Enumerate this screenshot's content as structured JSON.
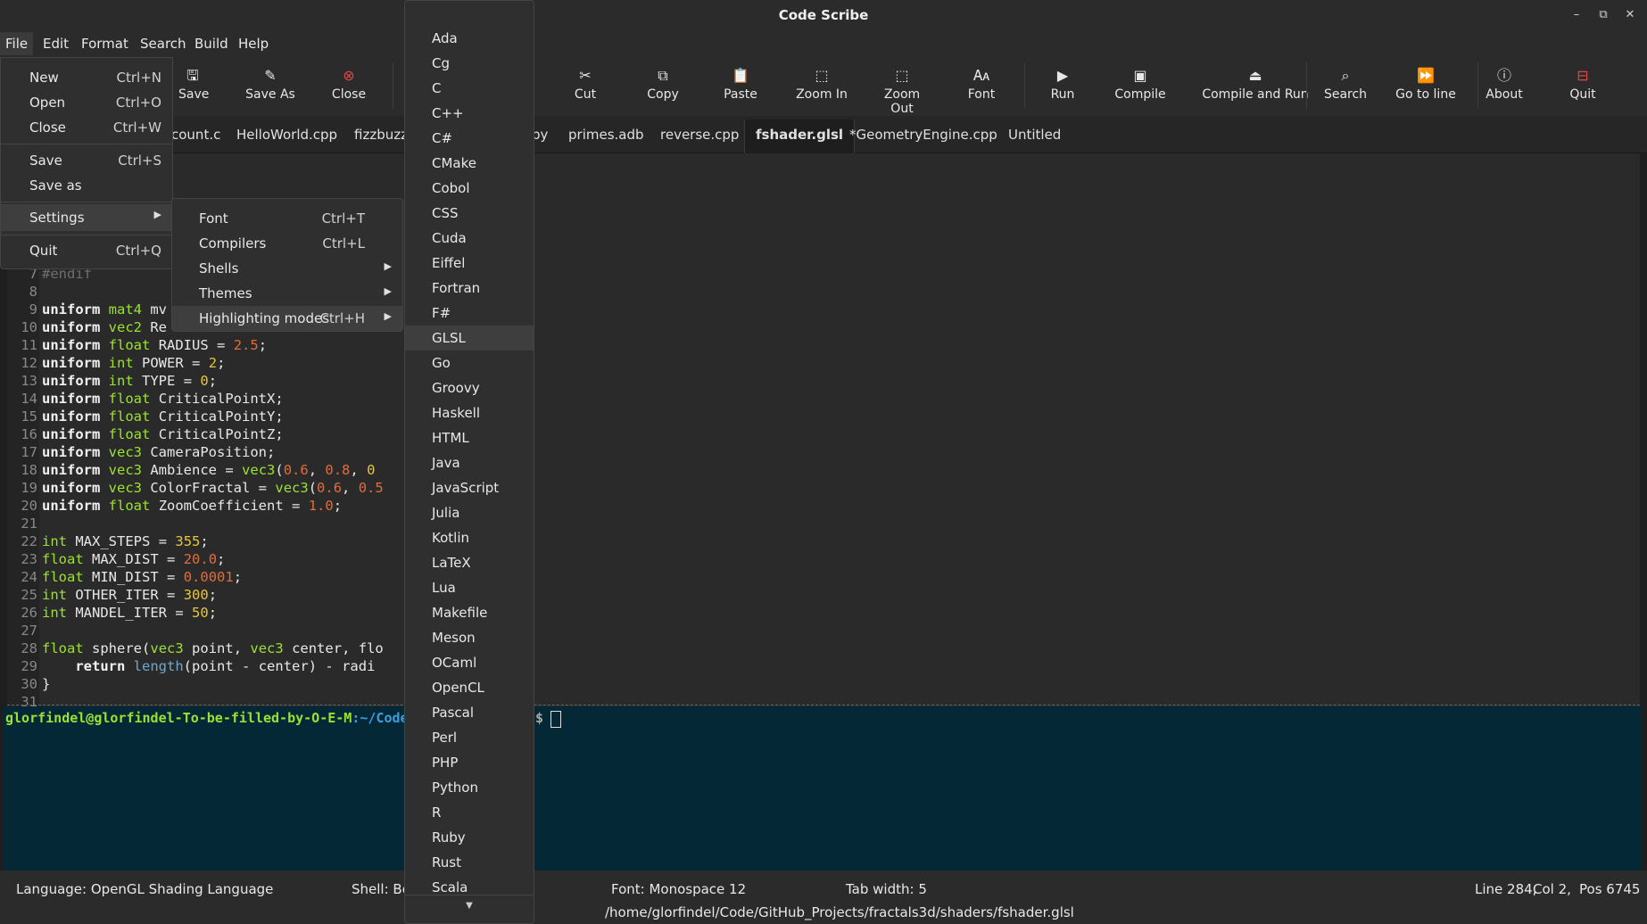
{
  "window": {
    "title": "Code Scribe"
  },
  "menubar": {
    "items": [
      "File",
      "Edit",
      "Format",
      "Search",
      "Build",
      "Help"
    ]
  },
  "toolbar": {
    "buttons": [
      {
        "label": "Save",
        "icon": "save-icon"
      },
      {
        "label": "Save As",
        "icon": "save-as-icon"
      },
      {
        "label": "Close",
        "icon": "close-circle-icon",
        "color": "#e04646"
      },
      {
        "label": "Cut",
        "icon": "scissors-icon"
      },
      {
        "label": "Copy",
        "icon": "copy-icon"
      },
      {
        "label": "Paste",
        "icon": "paste-icon"
      },
      {
        "label": "Zoom In",
        "icon": "zoom-in-icon"
      },
      {
        "label": "Zoom Out",
        "icon": "zoom-out-icon"
      },
      {
        "label": "Font",
        "icon": "font-icon"
      },
      {
        "label": "Run",
        "icon": "play-icon"
      },
      {
        "label": "Compile",
        "icon": "compile-icon"
      },
      {
        "label": "Compile and Run",
        "icon": "eject-icon"
      },
      {
        "label": "Search",
        "icon": "search-icon"
      },
      {
        "label": "Go to line",
        "icon": "fast-forward-icon"
      },
      {
        "label": "About",
        "icon": "info-icon"
      },
      {
        "label": "Quit",
        "icon": "quit-icon",
        "color": "#e04646"
      }
    ]
  },
  "tabs": {
    "items": [
      "count.c",
      "HelloWorld.cpp",
      "fizzbuzz",
      "py",
      "primes.adb",
      "reverse.cpp",
      "fshader.glsl",
      "*GeometryEngine.cpp",
      "Untitled"
    ],
    "active": "fshader.glsl"
  },
  "editor": {
    "lines": [
      {
        "n": "7",
        "code": "#endif"
      },
      {
        "n": "8",
        "code": ""
      },
      {
        "n": "9",
        "code": "uniform mat4 mv"
      },
      {
        "n": "10",
        "code": "uniform vec2 Re"
      },
      {
        "n": "11",
        "code": "uniform float RADIUS = 2.5;"
      },
      {
        "n": "12",
        "code": "uniform int POWER = 2;"
      },
      {
        "n": "13",
        "code": "uniform int TYPE = 0;"
      },
      {
        "n": "14",
        "code": "uniform float CriticalPointX;"
      },
      {
        "n": "15",
        "code": "uniform float CriticalPointY;"
      },
      {
        "n": "16",
        "code": "uniform float CriticalPointZ;"
      },
      {
        "n": "17",
        "code": "uniform vec3 CameraPosition;"
      },
      {
        "n": "18",
        "code": "uniform vec3 Ambience = vec3(0.6, 0.8, 0"
      },
      {
        "n": "19",
        "code": "uniform vec3 ColorFractal = vec3(0.6, 0.5"
      },
      {
        "n": "20",
        "code": "uniform float ZoomCoefficient = 1.0;"
      },
      {
        "n": "21",
        "code": ""
      },
      {
        "n": "22",
        "code": "int MAX_STEPS = 355;"
      },
      {
        "n": "23",
        "code": "float MAX_DIST = 20.0;"
      },
      {
        "n": "24",
        "code": "float MIN_DIST = 0.0001;"
      },
      {
        "n": "25",
        "code": "int OTHER_ITER = 300;"
      },
      {
        "n": "26",
        "code": "int MANDEL_ITER = 50;"
      },
      {
        "n": "27",
        "code": ""
      },
      {
        "n": "28",
        "code": "float sphere(vec3 point, vec3 center, flo"
      },
      {
        "n": "29",
        "code": "    return length(point - center) - radi"
      },
      {
        "n": "30",
        "code": "}"
      },
      {
        "n": "31",
        "code": ""
      }
    ]
  },
  "terminal": {
    "user_host": "glorfindel@glorfindel-To-be-filled-by-O-E-M",
    "path": ":~/Code",
    "dollar": "$"
  },
  "statusbar": {
    "language": "Language: OpenGL Shading Language",
    "shell": "Shell: Bo",
    "font": "Font: Monospace 12",
    "tab_width": "Tab width: 5",
    "line": "Line 284,",
    "col": "Col 2,",
    "pos": "Pos 6745",
    "filepath": "/home/glorfindel/Code/GitHub_Projects/fractals3d/shaders/fshader.glsl"
  },
  "file_menu": {
    "items": [
      {
        "label": "New",
        "shortcut": "Ctrl+N"
      },
      {
        "label": "Open",
        "shortcut": "Ctrl+O"
      },
      {
        "label": "Close",
        "shortcut": "Ctrl+W"
      },
      {
        "label": "Save",
        "shortcut": "Ctrl+S"
      },
      {
        "label": "Save as",
        "shortcut": ""
      },
      {
        "label": "Settings",
        "shortcut": ""
      },
      {
        "label": "Quit",
        "shortcut": "Ctrl+Q"
      }
    ]
  },
  "settings_menu": {
    "items": [
      {
        "label": "Font",
        "shortcut": "Ctrl+T"
      },
      {
        "label": "Compilers",
        "shortcut": "Ctrl+L"
      },
      {
        "label": "Shells",
        "shortcut": ""
      },
      {
        "label": "Themes",
        "shortcut": ""
      },
      {
        "label": "Highlighting modes",
        "shortcut": "Ctrl+H"
      }
    ]
  },
  "languages_menu": {
    "items": [
      "Ada",
      "Cg",
      "C",
      "C++",
      "C#",
      "CMake",
      "Cobol",
      "CSS",
      "Cuda",
      "Eiffel",
      "Fortran",
      "F#",
      "GLSL",
      "Go",
      "Groovy",
      "Haskell",
      "HTML",
      "Java",
      "JavaScript",
      "Julia",
      "Kotlin",
      "LaTeX",
      "Lua",
      "Makefile",
      "Meson",
      "OCaml",
      "OpenCL",
      "Pascal",
      "Perl",
      "PHP",
      "Python",
      "R",
      "Ruby",
      "Rust",
      "Scala"
    ],
    "highlighted": "GLSL"
  },
  "colors": {
    "keyword_type": "#9be230",
    "number": "#e06c3c",
    "integer": "#e6c63e",
    "terminal_bg": "#042836",
    "danger": "#e04646"
  }
}
